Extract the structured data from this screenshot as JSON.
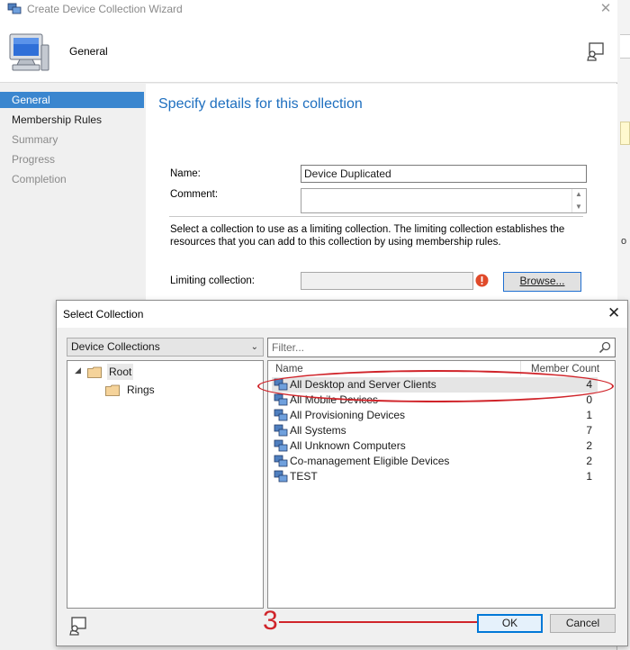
{
  "wizard": {
    "title": "Create Device Collection Wizard",
    "header_page": "General",
    "nav": [
      {
        "label": "General",
        "state": "active"
      },
      {
        "label": "Membership Rules",
        "state": "done"
      },
      {
        "label": "Summary",
        "state": "pending"
      },
      {
        "label": "Progress",
        "state": "pending"
      },
      {
        "label": "Completion",
        "state": "pending"
      }
    ],
    "heading": "Specify details for this collection",
    "name_label": "Name:",
    "name_value": "Device Duplicated",
    "comment_label": "Comment:",
    "comment_value": "",
    "description": "Select a collection to use as a limiting collection. The limiting collection establishes the resources that you can add to this collection by using membership rules.",
    "limiting_label": "Limiting collection:",
    "limiting_value": "",
    "browse_label": "Browse..."
  },
  "edge": {
    "partial_text": "o"
  },
  "dialog": {
    "title": "Select Collection",
    "close_glyph": "✕",
    "dropdown_value": "Device Collections",
    "filter_placeholder": "Filter...",
    "tree": [
      {
        "label": "Root",
        "level": 0,
        "selected": true
      },
      {
        "label": "Rings",
        "level": 1,
        "selected": false
      }
    ],
    "columns": {
      "name": "Name",
      "count": "Member Count"
    },
    "rows": [
      {
        "name": "All Desktop and Server Clients",
        "count": "4",
        "selected": true
      },
      {
        "name": "All Mobile Devices",
        "count": "0",
        "selected": false
      },
      {
        "name": "All Provisioning Devices",
        "count": "1",
        "selected": false
      },
      {
        "name": "All Systems",
        "count": "7",
        "selected": false
      },
      {
        "name": "All Unknown Computers",
        "count": "2",
        "selected": false
      },
      {
        "name": "Co-management Eligible Devices",
        "count": "2",
        "selected": false
      },
      {
        "name": "TEST",
        "count": "1",
        "selected": false
      }
    ],
    "ok_label": "OK",
    "cancel_label": "Cancel"
  },
  "annotation": {
    "number": "3",
    "color": "#d0242a"
  },
  "colors": {
    "accent": "#3a86cf",
    "heading": "#1e6fbf"
  }
}
